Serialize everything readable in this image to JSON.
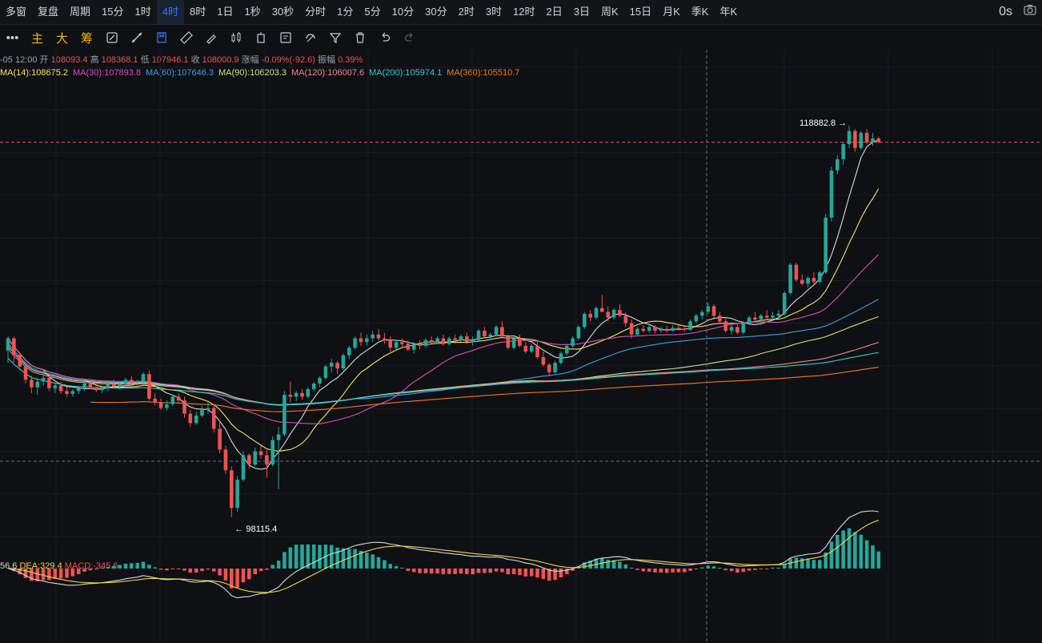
{
  "topbar": {
    "items": [
      "多窗",
      "复盘",
      "周期",
      "15分",
      "1时",
      "4时",
      "8时",
      "1日",
      "1秒",
      "30秒",
      "分时",
      "1分",
      "5分",
      "10分",
      "30分",
      "2时",
      "3时",
      "12时",
      "2日",
      "3日",
      "周K",
      "15日",
      "月K",
      "季K",
      "年K"
    ],
    "active": "4时",
    "right_label": "0s"
  },
  "toolbar": {
    "main_label": "主",
    "big_label": "大",
    "chip_label": "筹"
  },
  "ohlc": {
    "time": "-05 12:00",
    "open_label": "开",
    "open": "108093.4",
    "high_label": "高",
    "high": "108368.1",
    "low_label": "低",
    "low": "107946.1",
    "close_label": "收",
    "close": "108000.9",
    "change_label": "涨幅",
    "change": "-0.09%(-92.6)",
    "amp_label": "振幅",
    "amp": "0.39%"
  },
  "ma_legend": [
    {
      "label": "MA(14):108675.2",
      "color": "#f5e663"
    },
    {
      "label": "MA(30):107893.8",
      "color": "#d94fb8"
    },
    {
      "label": "MA(60):107646.3",
      "color": "#3aa0e8"
    },
    {
      "label": "MA(90):106203.3",
      "color": "#c9e68a"
    },
    {
      "label": "MA(120):106007.6",
      "color": "#ee8a8a"
    },
    {
      "label": "MA(200):105974.1",
      "color": "#2fd0cc"
    },
    {
      "label": "MA(360):105510.7",
      "color": "#f07d1a"
    }
  ],
  "macd_legend": {
    "dif": "56.6",
    "dea_label": "DEA:329.4",
    "macd_label": "MACD:-345.6"
  },
  "colors": {
    "up": "#26a69a",
    "down": "#ef5350",
    "bg": "#0e1014"
  },
  "chart_data": {
    "type": "candlestick",
    "interval": "4时",
    "price_range": [
      97000,
      121000
    ],
    "annotations": {
      "high": "118882.8",
      "low": "98115.4"
    },
    "candles": [
      [
        106950,
        107700,
        106300,
        107600
      ],
      [
        107600,
        107700,
        106300,
        106700
      ],
      [
        106700,
        106800,
        105900,
        106100
      ],
      [
        106100,
        106300,
        105200,
        105400
      ],
      [
        105400,
        105600,
        104700,
        105000
      ],
      [
        105000,
        105500,
        104600,
        105300
      ],
      [
        105300,
        105700,
        105100,
        105500
      ],
      [
        105500,
        105600,
        104800,
        104950
      ],
      [
        104950,
        105200,
        104700,
        105100
      ],
      [
        105100,
        105300,
        104650,
        104800
      ],
      [
        104800,
        105000,
        104500,
        104650
      ],
      [
        104650,
        104900,
        104500,
        104800
      ],
      [
        104800,
        105100,
        104650,
        104950
      ],
      [
        104950,
        105300,
        104800,
        105200
      ],
      [
        105200,
        105400,
        104900,
        105000
      ],
      [
        105000,
        105250,
        104750,
        104850
      ],
      [
        104850,
        105100,
        104700,
        104950
      ],
      [
        104950,
        105300,
        104800,
        105150
      ],
      [
        105150,
        105400,
        104950,
        105050
      ],
      [
        105050,
        105300,
        104900,
        105200
      ],
      [
        105200,
        105500,
        105000,
        105400
      ],
      [
        105400,
        105600,
        105100,
        105250
      ],
      [
        105250,
        105400,
        105050,
        105300
      ],
      [
        105300,
        105800,
        105200,
        105700
      ],
      [
        105700,
        105900,
        104300,
        104400
      ],
      [
        104400,
        104700,
        104050,
        104200
      ],
      [
        104200,
        104400,
        103800,
        103900
      ],
      [
        103900,
        104300,
        103750,
        104100
      ],
      [
        104100,
        104600,
        104000,
        104500
      ],
      [
        104500,
        104700,
        104200,
        104300
      ],
      [
        104300,
        104500,
        103400,
        103600
      ],
      [
        103600,
        103800,
        102900,
        103100
      ],
      [
        103100,
        103700,
        103000,
        103500
      ],
      [
        103500,
        104000,
        103400,
        103800
      ],
      [
        103800,
        104200,
        103600,
        103900
      ],
      [
        103900,
        104100,
        102600,
        102800
      ],
      [
        102800,
        103200,
        101500,
        101700
      ],
      [
        101700,
        101900,
        100400,
        100600
      ],
      [
        100600,
        100800,
        98115,
        98600
      ],
      [
        98600,
        100300,
        98400,
        100100
      ],
      [
        100100,
        101600,
        100000,
        101400
      ],
      [
        101400,
        101500,
        100700,
        100900
      ],
      [
        100900,
        101800,
        100800,
        101600
      ],
      [
        101600,
        101900,
        101200,
        101400
      ],
      [
        101400,
        101700,
        100200,
        100900
      ],
      [
        100900,
        102400,
        100800,
        102200
      ],
      [
        102200,
        102900,
        99600,
        102500
      ],
      [
        102500,
        104800,
        102400,
        104600
      ],
      [
        104600,
        105300,
        104200,
        104500
      ],
      [
        104500,
        104800,
        104250,
        104700
      ],
      [
        104700,
        104900,
        104350,
        104500
      ],
      [
        104500,
        105000,
        104400,
        104900
      ],
      [
        104900,
        105300,
        104800,
        105200
      ],
      [
        105200,
        105600,
        105000,
        105500
      ],
      [
        105500,
        106200,
        105400,
        106100
      ],
      [
        106100,
        106500,
        105800,
        106300
      ],
      [
        106300,
        106400,
        105700,
        106000
      ],
      [
        106000,
        106800,
        105900,
        106700
      ],
      [
        106700,
        107200,
        106500,
        107100
      ],
      [
        107100,
        107700,
        107000,
        107600
      ],
      [
        107600,
        107900,
        107200,
        107400
      ],
      [
        107400,
        107800,
        107200,
        107600
      ],
      [
        107600,
        108000,
        107400,
        107800
      ],
      [
        107800,
        108100,
        107500,
        107600
      ],
      [
        107600,
        107900,
        107300,
        107500
      ],
      [
        107500,
        107700,
        106900,
        107100
      ],
      [
        107100,
        107500,
        107000,
        107400
      ],
      [
        107400,
        107600,
        107100,
        107300
      ],
      [
        107300,
        107500,
        106900,
        107000
      ],
      [
        107000,
        107400,
        106800,
        107300
      ],
      [
        107300,
        107500,
        107000,
        107200
      ],
      [
        107200,
        107600,
        107100,
        107500
      ],
      [
        107500,
        107700,
        107300,
        107400
      ],
      [
        107400,
        107700,
        107300,
        107600
      ],
      [
        107600,
        107800,
        107200,
        107300
      ],
      [
        107300,
        107700,
        107200,
        107600
      ],
      [
        107600,
        107800,
        107400,
        107500
      ],
      [
        107500,
        107800,
        107400,
        107700
      ],
      [
        107700,
        107900,
        107300,
        107400
      ],
      [
        107400,
        107700,
        107200,
        107500
      ],
      [
        107500,
        108100,
        107400,
        108000
      ],
      [
        108000,
        108200,
        107600,
        107700
      ],
      [
        107700,
        107900,
        107500,
        107800
      ],
      [
        107800,
        108300,
        107700,
        108200
      ],
      [
        108200,
        108500,
        107600,
        107700
      ],
      [
        107700,
        107800,
        107000,
        107100
      ],
      [
        107100,
        107700,
        107000,
        107600
      ],
      [
        107600,
        107800,
        107100,
        107200
      ],
      [
        107200,
        107400,
        106800,
        106900
      ],
      [
        106900,
        107300,
        106800,
        107200
      ],
      [
        107200,
        107400,
        106500,
        106600
      ],
      [
        106600,
        106900,
        106100,
        106200
      ],
      [
        106200,
        106300,
        105600,
        105800
      ],
      [
        105800,
        106400,
        105700,
        106300
      ],
      [
        106300,
        106900,
        106200,
        106800
      ],
      [
        106800,
        107300,
        106700,
        107200
      ],
      [
        107200,
        107700,
        107100,
        107600
      ],
      [
        107600,
        108300,
        107500,
        108200
      ],
      [
        108200,
        109000,
        108100,
        108900
      ],
      [
        108900,
        109100,
        108500,
        108700
      ],
      [
        108700,
        109300,
        108600,
        109200
      ],
      [
        109200,
        109900,
        109100,
        109000
      ],
      [
        109000,
        109300,
        108500,
        108700
      ],
      [
        108700,
        109200,
        108600,
        109100
      ],
      [
        109100,
        109400,
        108700,
        108800
      ],
      [
        108800,
        109000,
        108200,
        108400
      ],
      [
        108400,
        108600,
        107600,
        107800
      ],
      [
        107800,
        108200,
        107700,
        108100
      ],
      [
        108100,
        108300,
        107900,
        108000
      ],
      [
        108000,
        108300,
        107900,
        108200
      ],
      [
        108200,
        108300,
        107850,
        108000
      ],
      [
        108000,
        108200,
        107900,
        108100
      ],
      [
        108100,
        108250,
        107900,
        108000
      ],
      [
        108000,
        108300,
        107950,
        108150
      ],
      [
        108150,
        108300,
        108000,
        108100
      ],
      [
        108100,
        108250,
        107950,
        108050
      ],
      [
        108050,
        108600,
        108000,
        108500
      ],
      [
        108500,
        108900,
        108400,
        108800
      ],
      [
        108800,
        109100,
        108600,
        109000
      ],
      [
        109000,
        109500,
        108900,
        109300
      ],
      [
        109300,
        109400,
        108700,
        108800
      ],
      [
        108800,
        109000,
        108400,
        108500
      ],
      [
        108500,
        108700,
        107900,
        108000
      ],
      [
        108000,
        108300,
        107800,
        108200
      ],
      [
        108200,
        108400,
        107800,
        107900
      ],
      [
        107900,
        108500,
        107800,
        108400
      ],
      [
        108400,
        108800,
        108300,
        108700
      ],
      [
        108700,
        109000,
        108500,
        108600
      ],
      [
        108600,
        108900,
        108300,
        108800
      ],
      [
        108800,
        109100,
        108600,
        108700
      ],
      [
        108700,
        109000,
        108500,
        108800
      ],
      [
        108800,
        109100,
        108700,
        108900
      ],
      [
        108900,
        110100,
        108800,
        110000
      ],
      [
        110000,
        111600,
        109900,
        111500
      ],
      [
        111500,
        111600,
        110600,
        110700
      ],
      [
        110700,
        111000,
        110400,
        110500
      ],
      [
        110500,
        110900,
        110300,
        110800
      ],
      [
        110800,
        111100,
        110500,
        110600
      ],
      [
        110600,
        111200,
        110500,
        111100
      ],
      [
        111100,
        114200,
        111000,
        114000
      ],
      [
        114000,
        116700,
        113800,
        116500
      ],
      [
        116500,
        117300,
        116300,
        117100
      ],
      [
        117100,
        118000,
        116800,
        117900
      ],
      [
        117900,
        118882,
        117700,
        118600
      ],
      [
        118600,
        118700,
        117500,
        117700
      ],
      [
        117700,
        118600,
        117600,
        118500
      ],
      [
        118500,
        118700,
        117900,
        118000
      ],
      [
        118000,
        118500,
        117800,
        118200
      ],
      [
        118200,
        118300,
        117950,
        118000
      ]
    ]
  }
}
